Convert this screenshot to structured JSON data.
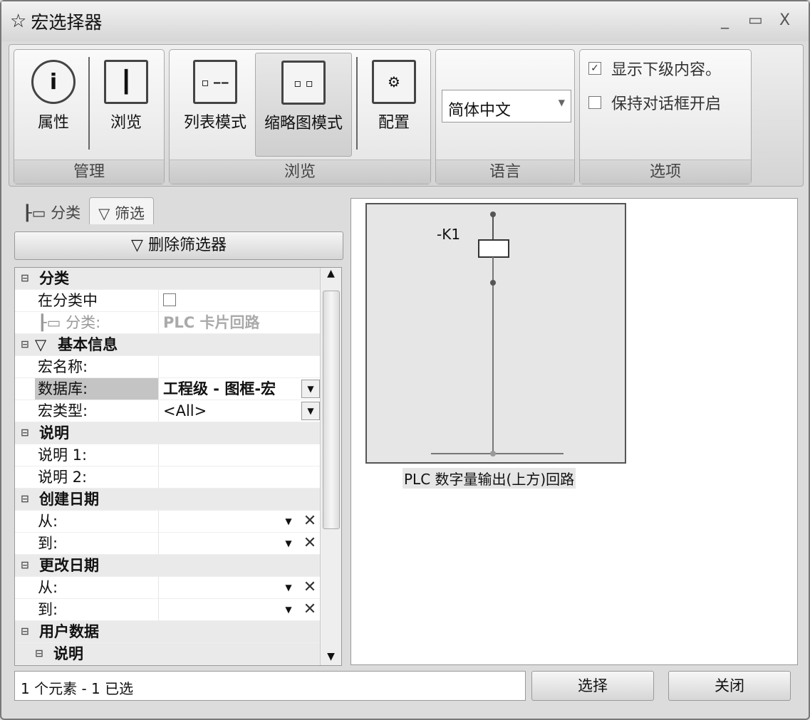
{
  "window": {
    "title": "宏选择器",
    "minimize": "_",
    "maximize": "▭",
    "close": "X"
  },
  "ribbon": {
    "manage": {
      "label": "管理",
      "properties": "属性",
      "browse": "浏览"
    },
    "browse": {
      "label": "浏览",
      "list_mode": "列表模式",
      "thumb_mode": "缩略图模式",
      "config": "配置"
    },
    "language": {
      "label": "语言",
      "value": "简体中文"
    },
    "options": {
      "label": "选项",
      "show_sub": "显示下级内容。",
      "show_sub_checked": true,
      "keep_open": "保持对话框开启",
      "keep_open_checked": false
    }
  },
  "left": {
    "tabs": [
      "分类",
      "筛选"
    ],
    "delete_filter": "删除筛选器",
    "rows": [
      {
        "type": "cat",
        "k": "分类"
      },
      {
        "k": "在分类中",
        "v": "",
        "check": true
      },
      {
        "k": "分类:",
        "v": "PLC 卡片回路",
        "disabled": true
      },
      {
        "type": "cat",
        "k": "基本信息"
      },
      {
        "k": "宏名称:",
        "v": ""
      },
      {
        "k": "数据库:",
        "v": "工程级 - 图框-宏",
        "dd": true,
        "hl": true
      },
      {
        "k": "宏类型:",
        "v": "<All>",
        "dd": true
      },
      {
        "type": "cat",
        "k": "说明"
      },
      {
        "k": "说明 1:",
        "v": ""
      },
      {
        "k": "说明 2:",
        "v": ""
      },
      {
        "type": "cat",
        "k": "创建日期"
      },
      {
        "k": "从:",
        "v": "",
        "date": true
      },
      {
        "k": "到:",
        "v": "",
        "date": true
      },
      {
        "type": "cat",
        "k": "更改日期"
      },
      {
        "k": "从:",
        "v": "",
        "date": true
      },
      {
        "k": "到:",
        "v": "",
        "date": true
      },
      {
        "type": "cat",
        "k": "用户数据"
      },
      {
        "type": "sub",
        "k": "说明"
      }
    ]
  },
  "preview": {
    "device_tag": "-K1",
    "caption": "PLC 数字量输出(上方)回路"
  },
  "footer": {
    "status": "1 个元素 - 1 已选",
    "select": "选择",
    "close": "关闭"
  }
}
